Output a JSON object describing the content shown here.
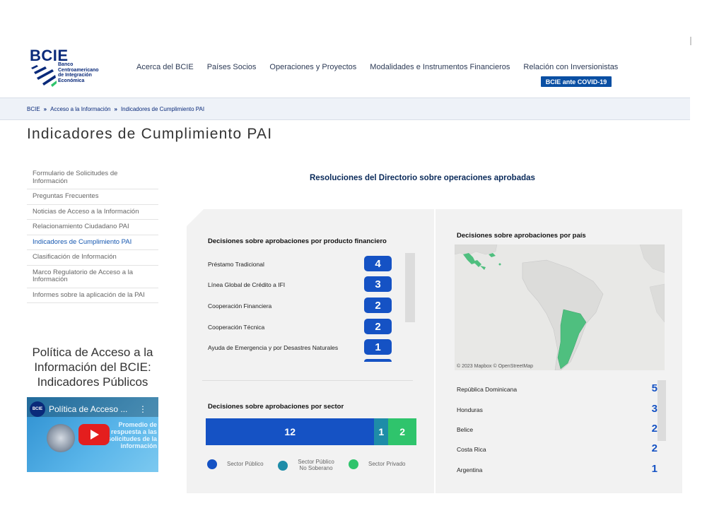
{
  "header": {
    "logo_word": "BCIE",
    "logo_sub": [
      "Banco",
      "Centroamericano",
      "de Integración",
      "Económica"
    ],
    "nav": [
      "Acerca del BCIE",
      "Países Socios",
      "Operaciones y Proyectos",
      "Modalidades e Instrumentos Financieros",
      "Relación con Inversionistas"
    ],
    "covid_button": "BCIE ante COVID-19"
  },
  "breadcrumb": {
    "items": [
      "BCIE",
      "Acceso a la Información",
      "Indicadores de Cumplimiento PAI"
    ],
    "separator": "»"
  },
  "page_title": "Indicadores de Cumplimiento PAI",
  "sidebar": {
    "items": [
      {
        "label": "Formulario de Solicitudes de Información",
        "active": false
      },
      {
        "label": "Preguntas Frecuentes",
        "active": false
      },
      {
        "label": "Noticias de Acceso a la Información",
        "active": false
      },
      {
        "label": "Relacionamiento Ciudadano PAI",
        "active": false
      },
      {
        "label": "Indicadores de Cumplimiento PAI",
        "active": true
      },
      {
        "label": "Clasificación de Información",
        "active": false
      },
      {
        "label": "Marco Regulatorio de Acceso a la Información",
        "active": false
      },
      {
        "label": "Informes sobre la aplicación de la PAI",
        "active": false
      }
    ]
  },
  "video": {
    "heading": "Política de Acceso a la Información del BCIE: Indicadores Públicos",
    "channel": "BCIE",
    "title": "Política de Acceso ...",
    "more": "⋮",
    "overlay": "Promedio de respuesta a las solicitudes de la información"
  },
  "dashboard": {
    "heading": "Resoluciones del Directorio sobre operaciones aprobadas",
    "product_title": "Decisiones sobre aprobaciones por producto financiero",
    "products": [
      {
        "label": "Préstamo Tradicional",
        "value": "4"
      },
      {
        "label": "Línea Global de Crédito a IFI",
        "value": "3"
      },
      {
        "label": "Cooperación Financiera",
        "value": "2"
      },
      {
        "label": "Cooperación Técnica",
        "value": "2"
      },
      {
        "label": "Ayuda de Emergencia y por Desastres Naturales",
        "value": "1"
      }
    ],
    "sector_title": "Decisiones sobre aprobaciones por sector",
    "sectors": [
      {
        "label": "Sector Público",
        "value": 12,
        "color": "#1552c4"
      },
      {
        "label": "Sector Público No Soberano",
        "value": 1,
        "color": "#1e8ca8"
      },
      {
        "label": "Sector Privado",
        "value": 2,
        "color": "#2fc46c"
      }
    ],
    "country_title": "Decisiones sobre aprobaciones por país",
    "map_credit": "© 2023 Mapbox © OpenStreetMap",
    "countries": [
      {
        "label": "República Dominicana",
        "value": "5"
      },
      {
        "label": "Honduras",
        "value": "3"
      },
      {
        "label": "Belice",
        "value": "2"
      },
      {
        "label": "Costa Rica",
        "value": "2"
      },
      {
        "label": "Argentina",
        "value": "1"
      }
    ]
  },
  "colors": {
    "primary": "#1552c4",
    "navy": "#0a2a7a",
    "teal": "#1e8ca8",
    "green": "#2fc46c",
    "map_highlight": "#4fbf7f"
  }
}
